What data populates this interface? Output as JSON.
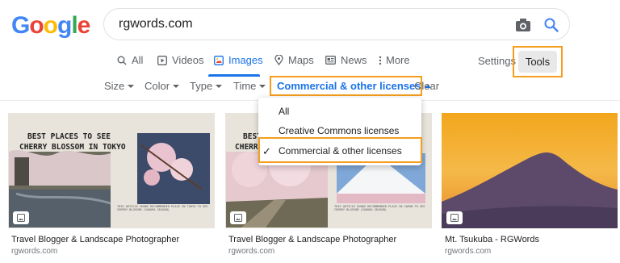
{
  "logo": {
    "text": "Google"
  },
  "search": {
    "query": "rgwords.com"
  },
  "tabs": [
    {
      "label": "All"
    },
    {
      "label": "Videos"
    },
    {
      "label": "Images"
    },
    {
      "label": "Maps"
    },
    {
      "label": "News"
    },
    {
      "label": "More"
    }
  ],
  "toolbar": {
    "settings_label": "Settings",
    "tools_label": "Tools"
  },
  "filters": [
    {
      "label": "Size"
    },
    {
      "label": "Color"
    },
    {
      "label": "Type"
    },
    {
      "label": "Time"
    },
    {
      "label": "Commercial & other licenses"
    },
    {
      "label": "Clear"
    }
  ],
  "license_dropdown": {
    "options": [
      "All",
      "Creative Commons licenses",
      "Commercial & other licenses"
    ],
    "selected": "Commercial & other licenses"
  },
  "results": [
    {
      "caption": "Travel Blogger & Landscape Photographer",
      "source": "rgwords.com",
      "image_title_line1": "BEST PLACES TO SEE",
      "image_title_line2": "CHERRY BLOSSOM IN TOKYO",
      "image_small_text": "THIS ARTICLE SHOWS RECOMMENDED PLACE IN TOKYO TO SEE CHERRY BLOSSOM (SAKURA SEASON)"
    },
    {
      "caption": "Travel Blogger & Landscape Photographer",
      "source": "rgwords.com",
      "image_title_line1": "BEST",
      "image_title_line2": "CHERR",
      "image_small_text": "THIS ARTICLE SHOWS RECOMMENDED PLACE IN JAPAN TO SEE CHERRY BLOSSOM (SAKURA SEASON)"
    },
    {
      "caption": "Mt. Tsukuba - RGWords",
      "source": "rgwords.com"
    }
  ],
  "colors": {
    "accent": "#1a73e8",
    "highlight": "#f59d1f",
    "logo": [
      "#4285f4",
      "#ea4335",
      "#fbbc05",
      "#4285f4",
      "#34a853",
      "#ea4335"
    ]
  }
}
